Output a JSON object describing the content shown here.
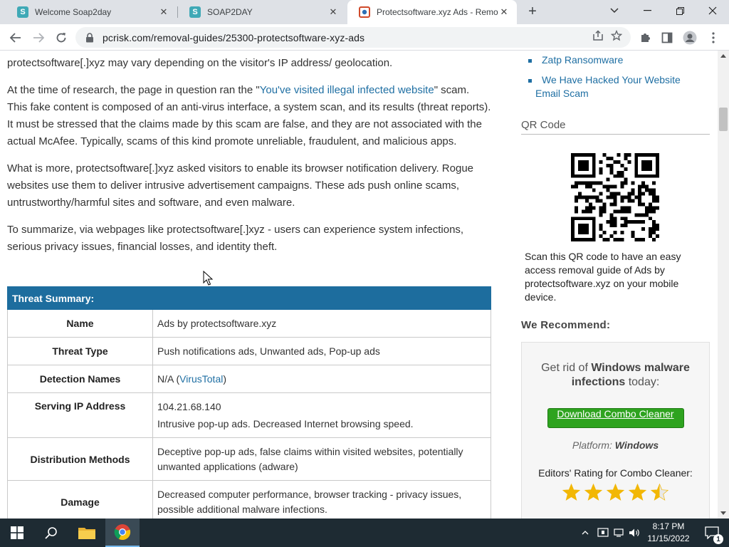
{
  "browser": {
    "tabs": [
      {
        "title": "Welcome Soap2day",
        "favicon_letter": "S",
        "favicon_color": "#3fa9b6",
        "active": false
      },
      {
        "title": "SOAP2DAY",
        "favicon_letter": "S",
        "favicon_color": "#3fa9b6",
        "active": false
      },
      {
        "title": "Protectsoftware.xyz Ads - Remov",
        "favicon_letter": "",
        "favicon_color": "#d04a2b",
        "active": true
      }
    ],
    "url": "pcrisk.com/removal-guides/25300-protectsoftware-xyz-ads"
  },
  "article": {
    "line_top": "protectsoftware[.]xyz may vary depending on the visitor's IP address/ geolocation.",
    "p1_before": "At the time of research, the page in question ran the \"",
    "p1_link": "You've visited illegal infected website",
    "p1_after": "\" scam. This fake content is composed of an anti-virus interface, a system scan, and its results (threat reports). It must be stressed that the claims made by this scam are false, and they are not associated with the actual McAfee. Typically, scams of this kind promote unreliable, fraudulent, and malicious apps.",
    "p2": "What is more, protectsoftware[.]xyz asked visitors to enable its browser notification delivery. Rogue websites use them to deliver intrusive advertisement campaigns. These ads push online scams, untrustworthy/harmful sites and software, and even malware.",
    "p3": "To summarize, via webpages like protectsoftware[.]xyz - users can experience system infections, serious privacy issues, financial losses, and identity theft."
  },
  "threat_summary": {
    "header": "Threat Summary:",
    "rows": [
      {
        "label": "Name",
        "value": "Ads by protectsoftware.xyz"
      },
      {
        "label": "Threat Type",
        "value": "Push notifications ads, Unwanted ads, Pop-up ads"
      },
      {
        "label": "Detection Names",
        "value_prefix": "N/A (",
        "value_link": "VirusTotal",
        "value_suffix": ")"
      },
      {
        "label": "Serving IP Address",
        "value_line1": "104.21.68.140",
        "value_line2": "Intrusive pop-up ads. Decreased Internet browsing speed."
      },
      {
        "label": "Distribution Methods",
        "value": "Deceptive pop-up ads, false claims within visited websites, potentially unwanted applications (adware)"
      },
      {
        "label": "Damage",
        "value": "Decreased computer performance, browser tracking - privacy issues, possible additional malware infections."
      }
    ]
  },
  "sidebar": {
    "links": [
      "Zatp Ransomware",
      "We Have Hacked Your Website Email Scam"
    ],
    "qr_title": "QR Code",
    "qr_text": "Scan this QR code to have an easy access removal guide of Ads by protectsoftware.xyz on your mobile device.",
    "recommend_title": "We Recommend:",
    "promo_lead_1": "Get rid of ",
    "promo_lead_bold": "Windows malware infections",
    "promo_lead_2": " today:",
    "download_label": "Download Combo Cleaner",
    "platform_label": "Platform: ",
    "platform_value": "Windows",
    "rating_label": "Editors' Rating for Combo Cleaner:",
    "rating_stars": 4.5,
    "rating_max": 5
  },
  "taskbar": {
    "time": "8:17 PM",
    "date": "11/15/2022",
    "notification_count": "1"
  },
  "colors": {
    "accent_blue": "#1f6fa3",
    "table_header": "#1d6d9e",
    "download_green": "#2ea31f",
    "star": "#f2b705"
  }
}
